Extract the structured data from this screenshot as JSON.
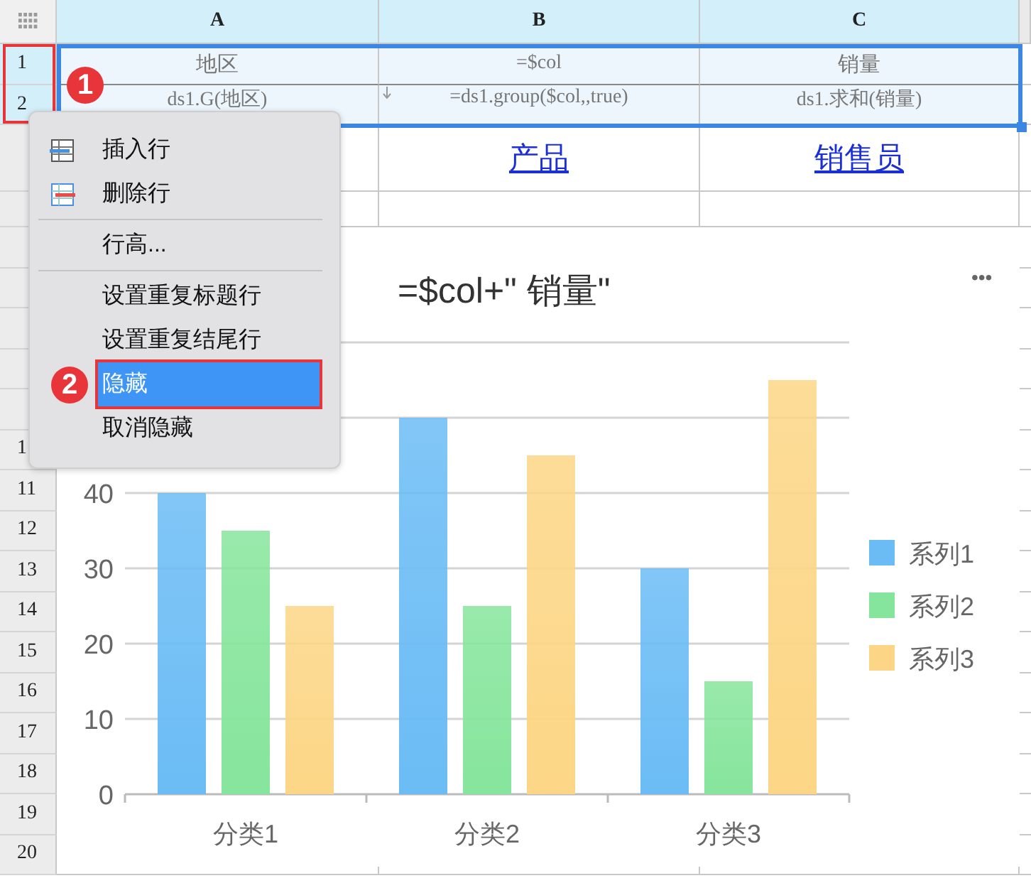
{
  "columns": [
    "A",
    "B",
    "C"
  ],
  "rows": [
    {
      "number": "1",
      "selected": true,
      "cells": [
        {
          "text": "地区",
          "kind": "text"
        },
        {
          "text": "=$col",
          "kind": "formula"
        },
        {
          "text": "销量",
          "kind": "text"
        }
      ]
    },
    {
      "number": "2",
      "selected": true,
      "cells": [
        {
          "text": "ds1.G(地区)",
          "kind": "formula"
        },
        {
          "text": "=ds1.group($col,,true)",
          "kind": "group-formula"
        },
        {
          "text": "ds1.求和(销量)",
          "kind": "formula"
        }
      ]
    },
    {
      "selected": false,
      "cells": [
        {
          "kind": "empty"
        },
        {
          "text": "产品",
          "kind": "link"
        },
        {
          "text": "销售员",
          "kind": "link"
        }
      ]
    },
    {
      "selected": false
    },
    {
      "selected": false
    },
    {
      "selected": false
    },
    {
      "selected": false
    },
    {
      "selected": false
    },
    {
      "selected": false
    },
    {
      "number": "1",
      "selected": false
    },
    {
      "number": "11",
      "selected": false
    },
    {
      "number": "12",
      "selected": false
    },
    {
      "number": "13",
      "selected": false
    },
    {
      "number": "14",
      "selected": false
    },
    {
      "number": "15",
      "selected": false
    },
    {
      "number": "16",
      "selected": false
    },
    {
      "number": "17",
      "selected": false
    },
    {
      "number": "18",
      "selected": false
    },
    {
      "number": "19",
      "selected": false
    },
    {
      "number": "20",
      "selected": false
    }
  ],
  "chart": {
    "title": "=$col+\" 销量\"",
    "more": "•••",
    "chart_data": {
      "type": "bar",
      "grid": true,
      "legend": true,
      "categories": [
        "分类1",
        "分类2",
        "分类3"
      ],
      "ylim": [
        0,
        60
      ],
      "yticks": [
        0,
        10,
        20,
        30,
        40
      ],
      "series": [
        {
          "name": "系列1",
          "color": "#6bbcf5",
          "values": [
            40,
            50,
            30
          ]
        },
        {
          "name": "系列2",
          "color": "#86e59c",
          "values": [
            35,
            25,
            15
          ]
        },
        {
          "name": "系列3",
          "color": "#fcd686",
          "values": [
            25,
            45,
            55
          ]
        }
      ]
    }
  },
  "context_menu": {
    "items": [
      {
        "kind": "insert",
        "label": "插入行",
        "selected": false
      },
      {
        "kind": "delete",
        "label": "删除行",
        "selected": false
      },
      {
        "kind": "separator"
      },
      {
        "kind": "plain",
        "label": "行高...",
        "selected": false
      },
      {
        "kind": "separator"
      },
      {
        "kind": "plain",
        "label": "设置重复标题行",
        "selected": false
      },
      {
        "kind": "plain",
        "label": "设置重复结尾行",
        "selected": false
      },
      {
        "kind": "plain",
        "label": "隐藏",
        "selected": true
      },
      {
        "kind": "plain",
        "label": "取消隐藏",
        "selected": false
      }
    ]
  },
  "callouts": [
    "1",
    "2"
  ]
}
